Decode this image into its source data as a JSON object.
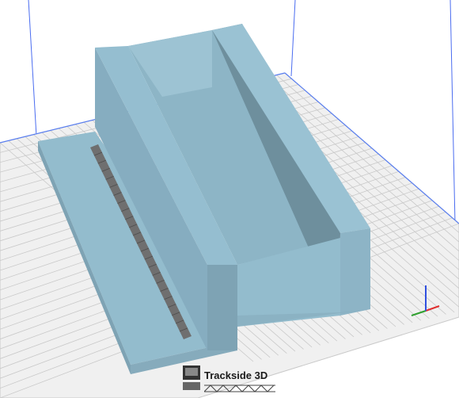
{
  "viewer": {
    "bed_color": "#f0f0f0",
    "grid_color": "#c9c9c9",
    "model_color": "#8fb7c8",
    "axis_colors": {
      "x": "#e03030",
      "y": "#30a030",
      "z": "#3050e0"
    }
  },
  "model": {
    "name": "",
    "icon": "3d-model-icon"
  },
  "watermark": {
    "brand": "Trackside 3D",
    "icon": "rail-bridge-icon"
  }
}
